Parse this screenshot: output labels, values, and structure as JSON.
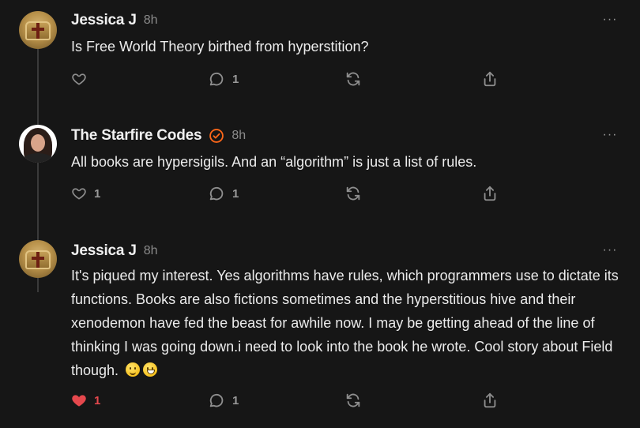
{
  "comments": [
    {
      "author": "Jessica J",
      "time": "8h",
      "text": "Is Free World Theory birthed from hyperstition?",
      "likes": "",
      "replies": "1",
      "liked": false,
      "avatar": "church-plaque-avatar"
    },
    {
      "author": "The Starfire Codes",
      "time": "8h",
      "text": "All books are hypersigils. And an “algorithm” is just a list of rules.",
      "likes": "1",
      "replies": "1",
      "liked": false,
      "verified": true,
      "avatar": "woman-portrait-avatar"
    },
    {
      "author": "Jessica J",
      "time": "8h",
      "text": "It's piqued my interest. Yes algorithms have rules, which programmers use to dictate its functions. Books are also fictions sometimes and the hyperstitious hive and their xenodemon have fed the beast for awhile now. I may be getting ahead of the line of thinking I was going down.i need to look into the book he wrote. Cool story about Field though.",
      "emojis": [
        "slightly-smiling-face",
        "grinning-face-with-smiling-eyes"
      ],
      "likes": "1",
      "replies": "1",
      "liked": true,
      "avatar": "church-plaque-avatar"
    }
  ],
  "more_label": "···",
  "colors": {
    "background": "#161616",
    "text": "#ececec",
    "muted": "#8e8e8e",
    "like_active": "#e5484d",
    "verified": "#ff6719"
  },
  "icons": [
    "heart-icon",
    "comment-icon",
    "restack-icon",
    "share-icon",
    "more-icon",
    "verified-check-icon"
  ]
}
